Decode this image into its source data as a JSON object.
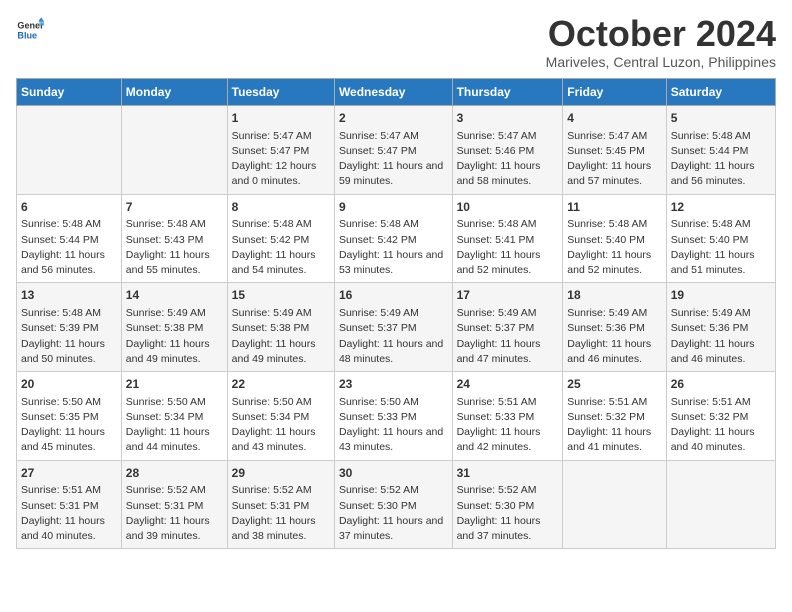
{
  "header": {
    "logo_line1": "General",
    "logo_line2": "Blue",
    "month": "October 2024",
    "location": "Mariveles, Central Luzon, Philippines"
  },
  "weekdays": [
    "Sunday",
    "Monday",
    "Tuesday",
    "Wednesday",
    "Thursday",
    "Friday",
    "Saturday"
  ],
  "rows": [
    [
      {
        "day": "",
        "sunrise": "",
        "sunset": "",
        "daylight": ""
      },
      {
        "day": "",
        "sunrise": "",
        "sunset": "",
        "daylight": ""
      },
      {
        "day": "1",
        "sunrise": "Sunrise: 5:47 AM",
        "sunset": "Sunset: 5:47 PM",
        "daylight": "Daylight: 12 hours and 0 minutes."
      },
      {
        "day": "2",
        "sunrise": "Sunrise: 5:47 AM",
        "sunset": "Sunset: 5:47 PM",
        "daylight": "Daylight: 11 hours and 59 minutes."
      },
      {
        "day": "3",
        "sunrise": "Sunrise: 5:47 AM",
        "sunset": "Sunset: 5:46 PM",
        "daylight": "Daylight: 11 hours and 58 minutes."
      },
      {
        "day": "4",
        "sunrise": "Sunrise: 5:47 AM",
        "sunset": "Sunset: 5:45 PM",
        "daylight": "Daylight: 11 hours and 57 minutes."
      },
      {
        "day": "5",
        "sunrise": "Sunrise: 5:48 AM",
        "sunset": "Sunset: 5:44 PM",
        "daylight": "Daylight: 11 hours and 56 minutes."
      }
    ],
    [
      {
        "day": "6",
        "sunrise": "Sunrise: 5:48 AM",
        "sunset": "Sunset: 5:44 PM",
        "daylight": "Daylight: 11 hours and 56 minutes."
      },
      {
        "day": "7",
        "sunrise": "Sunrise: 5:48 AM",
        "sunset": "Sunset: 5:43 PM",
        "daylight": "Daylight: 11 hours and 55 minutes."
      },
      {
        "day": "8",
        "sunrise": "Sunrise: 5:48 AM",
        "sunset": "Sunset: 5:42 PM",
        "daylight": "Daylight: 11 hours and 54 minutes."
      },
      {
        "day": "9",
        "sunrise": "Sunrise: 5:48 AM",
        "sunset": "Sunset: 5:42 PM",
        "daylight": "Daylight: 11 hours and 53 minutes."
      },
      {
        "day": "10",
        "sunrise": "Sunrise: 5:48 AM",
        "sunset": "Sunset: 5:41 PM",
        "daylight": "Daylight: 11 hours and 52 minutes."
      },
      {
        "day": "11",
        "sunrise": "Sunrise: 5:48 AM",
        "sunset": "Sunset: 5:40 PM",
        "daylight": "Daylight: 11 hours and 52 minutes."
      },
      {
        "day": "12",
        "sunrise": "Sunrise: 5:48 AM",
        "sunset": "Sunset: 5:40 PM",
        "daylight": "Daylight: 11 hours and 51 minutes."
      }
    ],
    [
      {
        "day": "13",
        "sunrise": "Sunrise: 5:48 AM",
        "sunset": "Sunset: 5:39 PM",
        "daylight": "Daylight: 11 hours and 50 minutes."
      },
      {
        "day": "14",
        "sunrise": "Sunrise: 5:49 AM",
        "sunset": "Sunset: 5:38 PM",
        "daylight": "Daylight: 11 hours and 49 minutes."
      },
      {
        "day": "15",
        "sunrise": "Sunrise: 5:49 AM",
        "sunset": "Sunset: 5:38 PM",
        "daylight": "Daylight: 11 hours and 49 minutes."
      },
      {
        "day": "16",
        "sunrise": "Sunrise: 5:49 AM",
        "sunset": "Sunset: 5:37 PM",
        "daylight": "Daylight: 11 hours and 48 minutes."
      },
      {
        "day": "17",
        "sunrise": "Sunrise: 5:49 AM",
        "sunset": "Sunset: 5:37 PM",
        "daylight": "Daylight: 11 hours and 47 minutes."
      },
      {
        "day": "18",
        "sunrise": "Sunrise: 5:49 AM",
        "sunset": "Sunset: 5:36 PM",
        "daylight": "Daylight: 11 hours and 46 minutes."
      },
      {
        "day": "19",
        "sunrise": "Sunrise: 5:49 AM",
        "sunset": "Sunset: 5:36 PM",
        "daylight": "Daylight: 11 hours and 46 minutes."
      }
    ],
    [
      {
        "day": "20",
        "sunrise": "Sunrise: 5:50 AM",
        "sunset": "Sunset: 5:35 PM",
        "daylight": "Daylight: 11 hours and 45 minutes."
      },
      {
        "day": "21",
        "sunrise": "Sunrise: 5:50 AM",
        "sunset": "Sunset: 5:34 PM",
        "daylight": "Daylight: 11 hours and 44 minutes."
      },
      {
        "day": "22",
        "sunrise": "Sunrise: 5:50 AM",
        "sunset": "Sunset: 5:34 PM",
        "daylight": "Daylight: 11 hours and 43 minutes."
      },
      {
        "day": "23",
        "sunrise": "Sunrise: 5:50 AM",
        "sunset": "Sunset: 5:33 PM",
        "daylight": "Daylight: 11 hours and 43 minutes."
      },
      {
        "day": "24",
        "sunrise": "Sunrise: 5:51 AM",
        "sunset": "Sunset: 5:33 PM",
        "daylight": "Daylight: 11 hours and 42 minutes."
      },
      {
        "day": "25",
        "sunrise": "Sunrise: 5:51 AM",
        "sunset": "Sunset: 5:32 PM",
        "daylight": "Daylight: 11 hours and 41 minutes."
      },
      {
        "day": "26",
        "sunrise": "Sunrise: 5:51 AM",
        "sunset": "Sunset: 5:32 PM",
        "daylight": "Daylight: 11 hours and 40 minutes."
      }
    ],
    [
      {
        "day": "27",
        "sunrise": "Sunrise: 5:51 AM",
        "sunset": "Sunset: 5:31 PM",
        "daylight": "Daylight: 11 hours and 40 minutes."
      },
      {
        "day": "28",
        "sunrise": "Sunrise: 5:52 AM",
        "sunset": "Sunset: 5:31 PM",
        "daylight": "Daylight: 11 hours and 39 minutes."
      },
      {
        "day": "29",
        "sunrise": "Sunrise: 5:52 AM",
        "sunset": "Sunset: 5:31 PM",
        "daylight": "Daylight: 11 hours and 38 minutes."
      },
      {
        "day": "30",
        "sunrise": "Sunrise: 5:52 AM",
        "sunset": "Sunset: 5:30 PM",
        "daylight": "Daylight: 11 hours and 37 minutes."
      },
      {
        "day": "31",
        "sunrise": "Sunrise: 5:52 AM",
        "sunset": "Sunset: 5:30 PM",
        "daylight": "Daylight: 11 hours and 37 minutes."
      },
      {
        "day": "",
        "sunrise": "",
        "sunset": "",
        "daylight": ""
      },
      {
        "day": "",
        "sunrise": "",
        "sunset": "",
        "daylight": ""
      }
    ]
  ]
}
